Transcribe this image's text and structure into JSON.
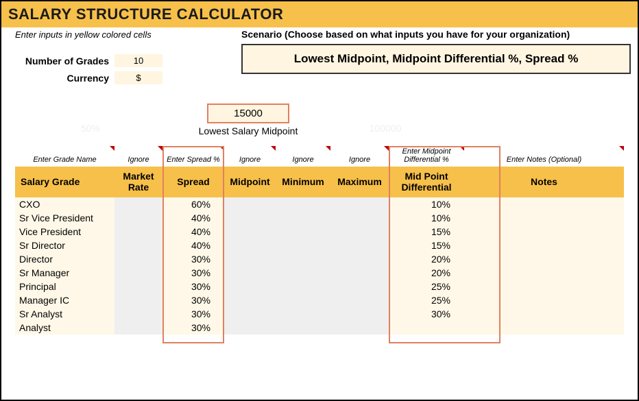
{
  "title": "SALARY STRUCTURE CALCULATOR",
  "instruction": "Enter inputs in yellow colored cells",
  "inputs": {
    "grades_label": "Number of Grades",
    "grades_value": "10",
    "currency_label": "Currency",
    "currency_value": "$"
  },
  "scenario": {
    "label": "Scenario (Choose based on what inputs you have for your organization)",
    "value": "Lowest Midpoint, Midpoint Differential %, Spread %"
  },
  "midpoint_row": {
    "faded_left": "50%",
    "lowest_value": "15000",
    "lowest_label": "Lowest Salary Midpoint",
    "faded_right": "100000"
  },
  "helpers": {
    "grade": "Enter Grade Name",
    "market": "Ignore",
    "spread": "Enter Spread %",
    "midpoint": "Ignore",
    "minimum": "Ignore",
    "maximum": "Ignore",
    "diff": "Enter Midpoint Differential %",
    "notes": "Enter Notes (Optional)"
  },
  "headers": {
    "grade": "Salary Grade",
    "market": "Market Rate",
    "spread": "Spread",
    "midpoint": "Midpoint",
    "minimum": "Minimum",
    "maximum": "Maximum",
    "diff": "Mid Point Differential",
    "notes": "Notes"
  },
  "rows": [
    {
      "grade": "CXO",
      "spread": "60%",
      "diff": "10%"
    },
    {
      "grade": "Sr Vice President",
      "spread": "40%",
      "diff": "10%"
    },
    {
      "grade": "Vice President",
      "spread": "40%",
      "diff": "15%"
    },
    {
      "grade": "Sr Director",
      "spread": "40%",
      "diff": "15%"
    },
    {
      "grade": "Director",
      "spread": "30%",
      "diff": "20%"
    },
    {
      "grade": "Sr Manager",
      "spread": "30%",
      "diff": "20%"
    },
    {
      "grade": "Principal",
      "spread": "30%",
      "diff": "25%"
    },
    {
      "grade": "Manager IC",
      "spread": "30%",
      "diff": "25%"
    },
    {
      "grade": "Sr Analyst",
      "spread": "30%",
      "diff": "30%"
    },
    {
      "grade": "Analyst",
      "spread": "30%",
      "diff": ""
    }
  ]
}
